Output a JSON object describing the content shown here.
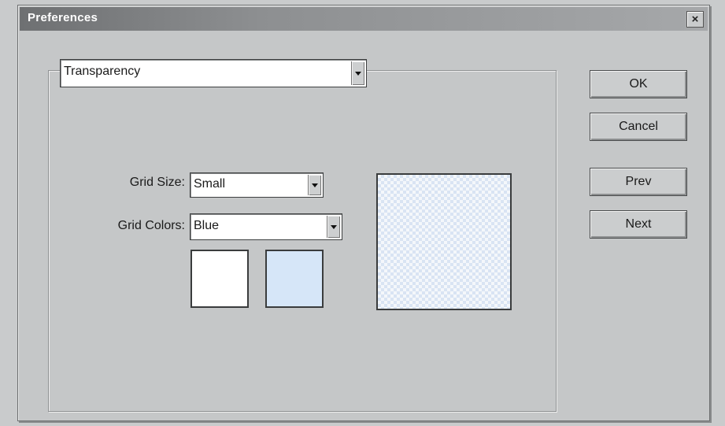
{
  "window": {
    "title": "Preferences",
    "close_glyph": "×"
  },
  "panel_select": {
    "value": "Transparency"
  },
  "grid_size": {
    "label": "Grid Size:",
    "value": "Small"
  },
  "grid_colors": {
    "label": "Grid Colors:",
    "value": "Blue",
    "swatch_1_color": "#ffffff",
    "swatch_2_color": "#d6e6f8"
  },
  "buttons": {
    "ok": "OK",
    "cancel": "Cancel",
    "prev": "Prev",
    "next": "Next"
  }
}
